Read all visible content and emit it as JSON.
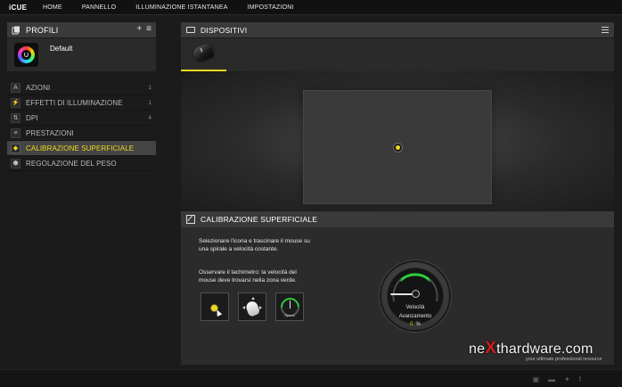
{
  "app": {
    "brand": "iCUE"
  },
  "nav": [
    "HOME",
    "PANNELLO",
    "ILLUMINAZIONE ISTANTANEA",
    "IMPOSTAZIONI"
  ],
  "profiles": {
    "title": "PROFILI",
    "add_icon": "plus-icon",
    "menu_icon": "hamburger-icon",
    "current": "Default"
  },
  "menu": [
    {
      "label": "AZIONI",
      "count": "1",
      "icon": "A",
      "active": false
    },
    {
      "label": "EFFETTI DI ILLUMINAZIONE",
      "count": "1",
      "icon": "⚡",
      "active": false
    },
    {
      "label": "DPI",
      "count": "4",
      "icon": "⇅",
      "active": false
    },
    {
      "label": "PRESTAZIONI",
      "count": "",
      "icon": "≡",
      "active": false
    },
    {
      "label": "CALIBRAZIONE SUPERFICIALE",
      "count": "",
      "icon": "◆",
      "active": true
    },
    {
      "label": "REGOLAZIONE DEL PESO",
      "count": "",
      "icon": "⬢",
      "active": false
    }
  ],
  "devices": {
    "title": "DISPOSITIVI"
  },
  "calibration": {
    "title": "CALIBRAZIONE SUPERFICIALE",
    "instruction1": "Selezionare l'icona e trascinare il mouse su una spirale a velocità costante.",
    "instruction2": "Osservare il tachimetro: la velocità del mouse deve trovarsi nella zona verde.",
    "speed_tile_label": "Speed",
    "gauge": {
      "velocity_label": "Velocità",
      "progress_label": "Avanzamento",
      "progress_value": "0",
      "progress_unit": "%",
      "green_zone_color": "#2ecc40"
    }
  },
  "watermark": {
    "main_prefix": "ne",
    "main_x": "X",
    "main_suffix": "thardware.com",
    "tagline": "your ultimate professional resource"
  },
  "colors": {
    "accent": "#f0d81f",
    "panel": "#2a2a2a",
    "background": "#1b1b1b"
  }
}
